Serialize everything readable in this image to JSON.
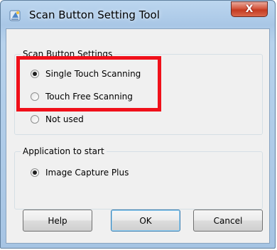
{
  "window": {
    "title": "Scan Button Setting Tool"
  },
  "icons": {
    "app": "scanner-app-icon",
    "close": "close-icon",
    "close_glyph": "X"
  },
  "scan_button_settings": {
    "title": "Scan Button Settings",
    "options": [
      {
        "label": "Single Touch Scanning",
        "selected": true
      },
      {
        "label": "Touch Free Scanning",
        "selected": false
      },
      {
        "label": "Not used",
        "selected": false
      }
    ]
  },
  "application_to_start": {
    "title": "Application to start",
    "options": [
      {
        "label": "Image Capture Plus",
        "selected": true
      }
    ]
  },
  "buttons": {
    "help": "Help",
    "ok": "OK",
    "cancel": "Cancel"
  },
  "colors": {
    "highlight": "#f0101a"
  }
}
